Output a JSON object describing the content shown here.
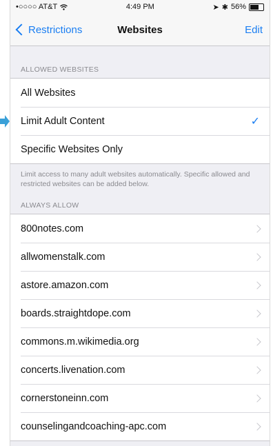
{
  "status_bar": {
    "carrier": "•○○○○ AT&T",
    "wifi_icon": "wifi-icon",
    "time": "4:49 PM",
    "location_icon": "location-arrow-icon",
    "bluetooth_icon": "bluetooth-icon",
    "battery_percent": "56%"
  },
  "nav": {
    "back_label": "Restrictions",
    "title": "Websites",
    "edit_label": "Edit"
  },
  "allowed": {
    "header": "ALLOWED WEBSITES",
    "options": [
      {
        "label": "All Websites",
        "selected": false
      },
      {
        "label": "Limit Adult Content",
        "selected": true
      },
      {
        "label": "Specific Websites Only",
        "selected": false
      }
    ],
    "checkmark": "✓",
    "footer": "Limit access to many adult websites automatically. Specific allowed and restricted websites can be added below."
  },
  "always_allow": {
    "header": "ALWAYS ALLOW",
    "sites": [
      "800notes.com",
      "allwomenstalk.com",
      "astore.amazon.com",
      "boards.straightdope.com",
      "commons.m.wikimedia.org",
      "concerts.livenation.com",
      "cornerstoneinn.com",
      "counselingandcoaching-apc.com"
    ]
  },
  "colors": {
    "accent": "#1a7ef2",
    "callout": "#3aa0d8",
    "background": "#efeff4"
  }
}
